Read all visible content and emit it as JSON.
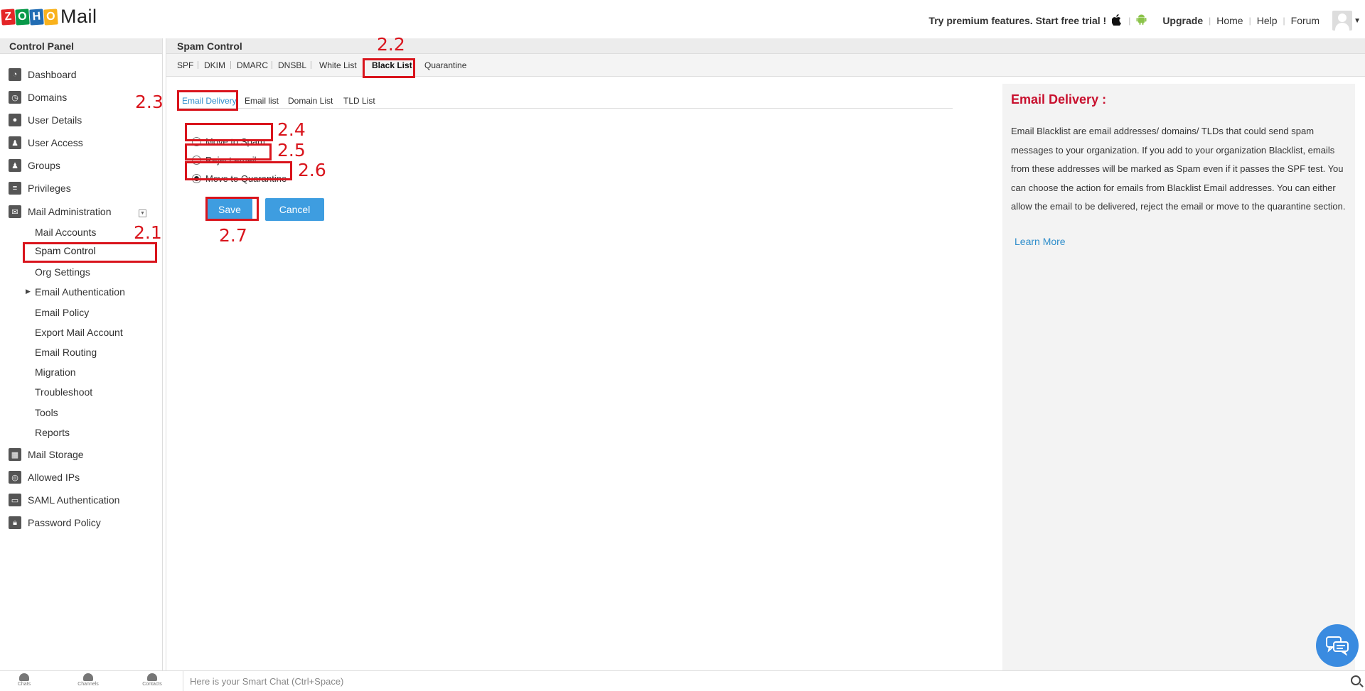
{
  "app": {
    "logo_letters": [
      "Z",
      "O",
      "H",
      "O"
    ],
    "logo_colors": [
      "#e42527",
      "#089949",
      "#226db4",
      "#f9b21d"
    ],
    "logo_text": "Mail"
  },
  "topbar": {
    "trial_text": "Try premium features. Start free trial !",
    "links": {
      "upgrade": "Upgrade",
      "home": "Home",
      "help": "Help",
      "forum": "Forum"
    },
    "icons": [
      "apple-icon",
      "android-icon",
      "avatar"
    ]
  },
  "sidebar": {
    "header": "Control Panel",
    "items": {
      "dashboard": "Dashboard",
      "domains": "Domains",
      "user_details": "User Details",
      "user_access": "User Access",
      "groups": "Groups",
      "privileges": "Privileges",
      "mail_administration": "Mail Administration",
      "mail_storage": "Mail Storage",
      "allowed_ips": "Allowed IPs",
      "saml_authentication": "SAML Authentication",
      "password_policy": "Password Policy"
    },
    "sub_items": {
      "mail_accounts": "Mail Accounts",
      "spam_control": "Spam Control",
      "org_settings": "Org Settings",
      "email_authentication": "Email Authentication",
      "email_policy": "Email Policy",
      "export_mail_account": "Export Mail Account",
      "email_routing": "Email Routing",
      "migration": "Migration",
      "troubleshoot": "Troubleshoot",
      "tools": "Tools",
      "reports": "Reports"
    },
    "selected": "Spam Control"
  },
  "main": {
    "header": "Spam Control",
    "tabs": {
      "spf": "SPF",
      "dkim": "DKIM",
      "dmarc": "DMARC",
      "dnsbl": "DNSBL",
      "white_list": "White List",
      "black_list": "Black List",
      "quarantine": "Quarantine"
    },
    "active_tab": "Black List",
    "subtabs": {
      "email_delivery": "Email Delivery",
      "email_list": "Email list",
      "domain_list": "Domain List",
      "tld_list": "TLD List"
    },
    "active_subtab": "Email Delivery",
    "options": {
      "move_to_spam": "Move to Spam",
      "reject_email": "Reject email",
      "move_to_quarantine": "Move to Quarantine"
    },
    "selected_option": "Move to Quarantine",
    "buttons": {
      "save": "Save",
      "cancel": "Cancel"
    }
  },
  "annotations": {
    "a21": "2.1",
    "a22": "2.2",
    "a23": "2.3",
    "a24": "2.4",
    "a25": "2.5",
    "a26": "2.6",
    "a27": "2.7"
  },
  "info_panel": {
    "title": "Email Delivery :",
    "body": "Email Blacklist are email addresses/ domains/ TLDs that could send spam messages to your organization. If you add to your organization Blacklist, emails from these addresses will be marked as Spam even if it passes the SPF test. You can choose the action for emails from Blacklist Email addresses. You can either allow the email to be delivered, reject the email or move to the quarantine section.",
    "link": "Learn More"
  },
  "bottombar": {
    "chats": "Chats",
    "channels": "Channels",
    "contacts": "Contacts",
    "smartchat_placeholder": "Here is your Smart Chat (Ctrl+Space)"
  },
  "colors": {
    "accent": "#3e9de0",
    "annotation_red": "#d9141c",
    "info_title": "#c8102e",
    "link": "#2f8ecb"
  }
}
